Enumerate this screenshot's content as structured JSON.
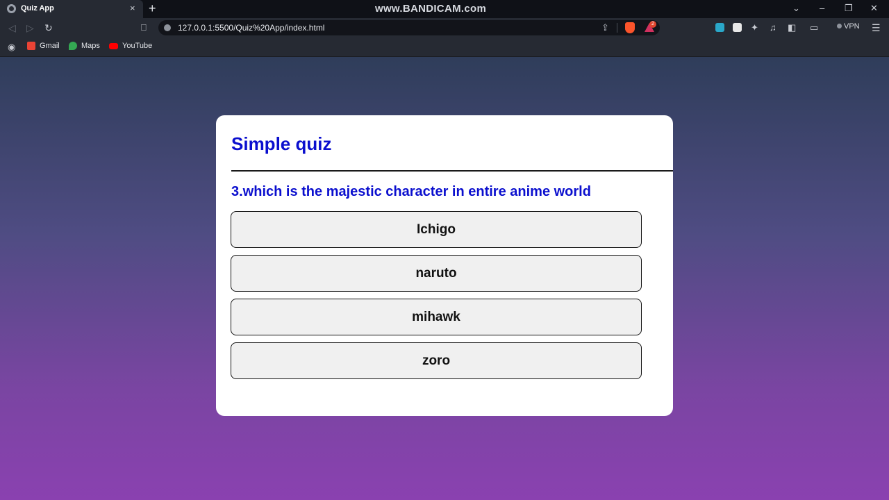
{
  "browser": {
    "tab_title": "Quiz App",
    "tab_close": "×",
    "new_tab": "+",
    "watermark": "www.BANDICAM.com",
    "window_controls": {
      "chevron": "⌄",
      "minimize": "–",
      "restore": "❐",
      "close": "✕"
    },
    "url": "127.0.0.1:5500/Quiz%20App/index.html",
    "vpn_label": "VPN",
    "rewards_badge": "2",
    "icons": [
      "back-icon",
      "forward-icon",
      "reload-icon",
      "bookmark-icon",
      "site-info-icon",
      "share-icon",
      "brave-shields-icon",
      "brave-rewards-icon",
      "extensions-icon",
      "media-icon",
      "sidebar-icon",
      "wallet-icon",
      "menu-icon"
    ]
  },
  "bookmarks": [
    {
      "label": "Gmail",
      "icon": "gmail-icon",
      "color": "#ea4335"
    },
    {
      "label": "Maps",
      "icon": "maps-icon",
      "color": "#34a853"
    },
    {
      "label": "YouTube",
      "icon": "youtube-icon",
      "color": "#ff0000"
    }
  ],
  "quiz": {
    "title": "Simple quiz",
    "question": "3.which is the majestic character in entire anime world",
    "answers": [
      "Ichigo",
      "naruto",
      "mihawk",
      "zoro"
    ]
  },
  "colors": {
    "accent": "#0b0fce",
    "gradient_top": "#2f3d5a",
    "gradient_bottom": "#8a41b0",
    "answer_bg": "#f0f0f0"
  }
}
